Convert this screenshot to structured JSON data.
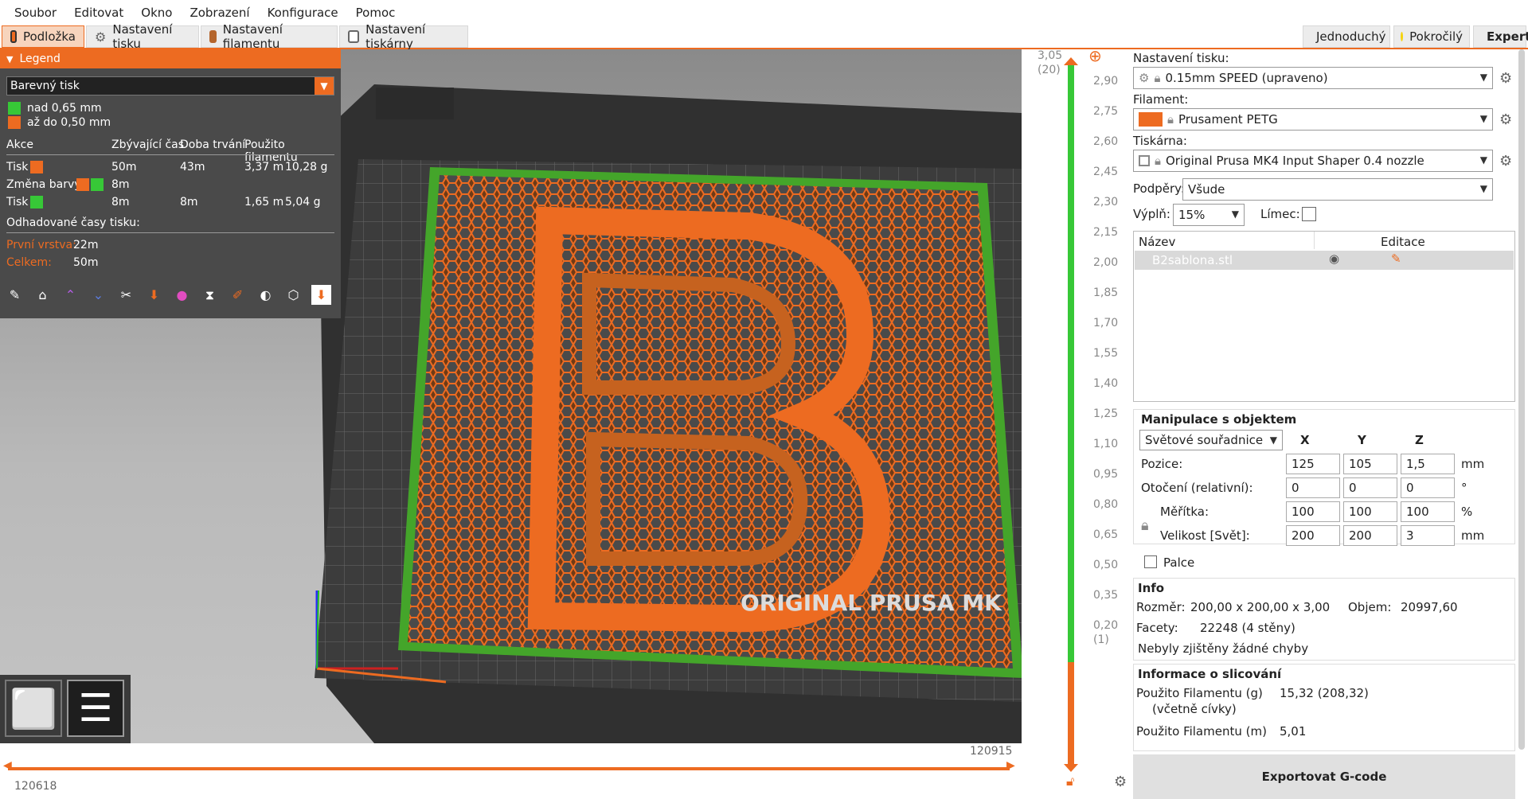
{
  "menu": [
    "Soubor",
    "Editovat",
    "Okno",
    "Zobrazení",
    "Konfigurace",
    "Pomoc"
  ],
  "tabs": [
    {
      "label": "Podložka",
      "active": true
    },
    {
      "label": "Nastavení tisku",
      "active": false
    },
    {
      "label": "Nastavení filamentu",
      "active": false
    },
    {
      "label": "Nastavení tiskárny",
      "active": false
    }
  ],
  "modes": [
    {
      "label": "Jednoduchý",
      "color": "#37c837"
    },
    {
      "label": "Pokročilý",
      "color": "#f5d30f"
    },
    {
      "label": "Expert",
      "color": "#e8141e",
      "active": true
    }
  ],
  "legend": {
    "title": "Legend",
    "view_type": "Barevný tisk",
    "ranges": [
      {
        "label": "nad 0,65 mm",
        "color": "#37c837"
      },
      {
        "label": "až do 0,50 mm",
        "color": "#ed6b21"
      }
    ],
    "columns": [
      "Akce",
      "Zbývající čas",
      "Doba trvání",
      "Použito filamentu"
    ],
    "rows": [
      {
        "action": "Tisk",
        "colors": [
          "#ed6b21"
        ],
        "remaining": "50m",
        "duration": "43m",
        "length": "3,37 m",
        "weight": "10,28 g"
      },
      {
        "action": "Změna barvy",
        "colors": [
          "#ed6b21",
          "#37c837"
        ],
        "remaining": "8m",
        "duration": "",
        "length": "",
        "weight": ""
      },
      {
        "action": "Tisk",
        "colors": [
          "#37c837"
        ],
        "remaining": "8m",
        "duration": "8m",
        "length": "1,65 m",
        "weight": "5,04 g"
      }
    ],
    "estimated_label": "Odhadované časy tisku:",
    "first_layer_label": "První vrstva:",
    "first_layer_value": "22m",
    "total_label": "Celkem:",
    "total_value": "50m"
  },
  "hslider": {
    "left_value": "120618",
    "right_value": "120915"
  },
  "vslider": {
    "top_value": "3,05",
    "top_layer": "(20)",
    "bottom_value": "0,20",
    "bottom_layer": "(1)",
    "ticks": [
      "2,90",
      "2,75",
      "2,60",
      "2,45",
      "2,30",
      "2,15",
      "2,00",
      "1,85",
      "1,70",
      "1,55",
      "1,40",
      "1,25",
      "1,10",
      "0,95",
      "0,80",
      "0,65",
      "0,50",
      "0,35"
    ],
    "color_change_at": "0,65"
  },
  "right": {
    "print_settings_label": "Nastavení tisku:",
    "print_settings_value": "0.15mm SPEED (upraveno)",
    "filament_label": "Filament:",
    "filament_value": "Prusament PETG",
    "filament_color": "#ed6b21",
    "printer_label": "Tiskárna:",
    "printer_value": "Original Prusa MK4 Input Shaper 0.4 nozzle",
    "supports_label": "Podpěry:",
    "supports_value": "Všude",
    "infill_label": "Výplň:",
    "infill_value": "15%",
    "brim_label": "Límec:",
    "list_header_name": "Název",
    "list_header_edit": "Editace",
    "object_name": "B2sablona.stl",
    "manip_title": "Manipulace s objektem",
    "coord_system": "Světové souřadnice",
    "axes": [
      "X",
      "Y",
      "Z"
    ],
    "position_label": "Pozice:",
    "position": [
      "125",
      "105",
      "1,5"
    ],
    "position_unit": "mm",
    "rotation_label": "Otočení (relativní):",
    "rotation": [
      "0",
      "0",
      "0"
    ],
    "rotation_unit": "°",
    "scale_label": "Měřítka:",
    "scale": [
      "100",
      "100",
      "100"
    ],
    "scale_unit": "%",
    "size_label": "Velikost [Svět]:",
    "size": [
      "200",
      "200",
      "3"
    ],
    "size_unit": "mm",
    "inches_label": "Palce",
    "info_title": "Info",
    "size_info_label": "Rozměr:",
    "size_info_value": "200,00 x 200,00 x 3,00",
    "volume_label": "Objem:",
    "volume_value": "20997,60",
    "facets_label": "Facety:",
    "facets_value": "22248 (4 stěny)",
    "errors_text": "Nebyly zjištěny žádné chyby",
    "slice_title": "Informace o slicování",
    "filament_g_label": "Použito Filamentu (g)",
    "filament_g_sub": "(včetně cívky)",
    "filament_g_value": "15,32 (208,32)",
    "filament_m_label": "Použito Filamentu (m)",
    "filament_m_value": "5,01",
    "export_label": "Exportovat G-code"
  }
}
